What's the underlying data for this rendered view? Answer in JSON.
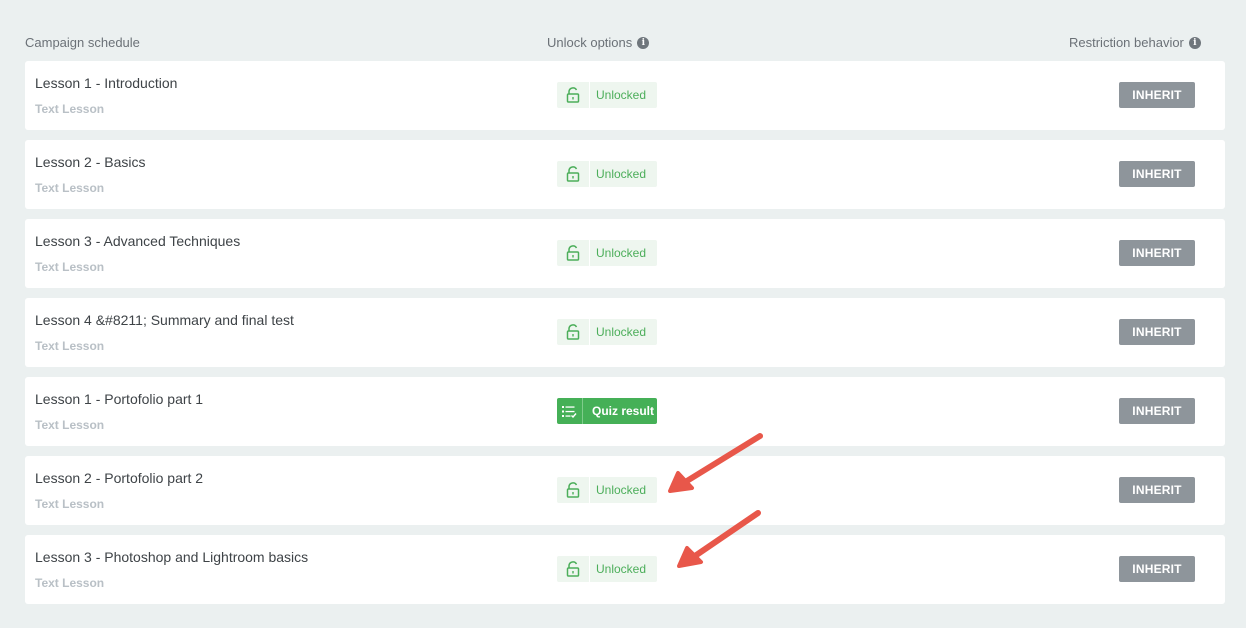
{
  "header": {
    "schedule_label": "Campaign schedule",
    "unlock_label": "Unlock options",
    "restriction_label": "Restriction behavior"
  },
  "colors": {
    "background": "#ebf0f0",
    "unlock_green": "#4cae5a",
    "quiz_green": "#45b057",
    "inherit_gray": "#8e959b",
    "arrow_red": "#e8574a"
  },
  "lessons": [
    {
      "title": "Lesson 1 - Introduction",
      "type": "Text Lesson",
      "unlock_status": "Unlocked",
      "unlock_icon": "unlock-icon",
      "restriction": "INHERIT"
    },
    {
      "title": "Lesson 2 - Basics",
      "type": "Text Lesson",
      "unlock_status": "Unlocked",
      "unlock_icon": "unlock-icon",
      "restriction": "INHERIT"
    },
    {
      "title": "Lesson 3 - Advanced Techniques",
      "type": "Text Lesson",
      "unlock_status": "Unlocked",
      "unlock_icon": "unlock-icon",
      "restriction": "INHERIT"
    },
    {
      "title": "Lesson 4 &#8211; Summary and final test",
      "type": "Text Lesson",
      "unlock_status": "Unlocked",
      "unlock_icon": "unlock-icon",
      "restriction": "INHERIT"
    },
    {
      "title": "Lesson 1 - Portofolio part 1",
      "type": "Text Lesson",
      "unlock_status": "Quiz result",
      "unlock_icon": "quiz-list-icon",
      "restriction": "INHERIT"
    },
    {
      "title": "Lesson 2 - Portofolio part 2",
      "type": "Text Lesson",
      "unlock_status": "Unlocked",
      "unlock_icon": "unlock-icon",
      "restriction": "INHERIT"
    },
    {
      "title": "Lesson 3 - Photoshop and Lightroom basics",
      "type": "Text Lesson",
      "unlock_status": "Unlocked",
      "unlock_icon": "unlock-icon",
      "restriction": "INHERIT"
    }
  ]
}
